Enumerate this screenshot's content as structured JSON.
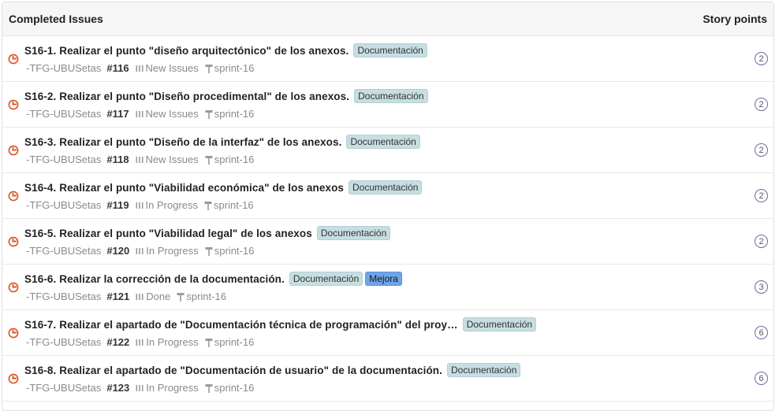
{
  "header": {
    "title": "Completed Issues",
    "story_points_label": "Story points"
  },
  "colors": {
    "issue_icon": "#d9531e",
    "label_doc": "#c6dee2",
    "label_mejora": "#6fa4e8",
    "points_border": "#6a6aa8"
  },
  "issues": [
    {
      "title": "S16-1. Realizar el punto \"diseño arquitectónico\" de los anexos.",
      "labels": [
        "Documentación"
      ],
      "repo": "-TFG-UBUSetas",
      "number": "#116",
      "status": "New Issues",
      "sprint": "sprint-16",
      "points": "2"
    },
    {
      "title": "S16-2. Realizar el punto \"Diseño procedimental\" de los anexos.",
      "labels": [
        "Documentación"
      ],
      "repo": "-TFG-UBUSetas",
      "number": "#117",
      "status": "New Issues",
      "sprint": "sprint-16",
      "points": "2"
    },
    {
      "title": "S16-3. Realizar el punto \"Diseño de la interfaz\" de los anexos.",
      "labels": [
        "Documentación"
      ],
      "repo": "-TFG-UBUSetas",
      "number": "#118",
      "status": "New Issues",
      "sprint": "sprint-16",
      "points": "2"
    },
    {
      "title": "S16-4. Realizar el punto \"Viabilidad económica\" de los anexos",
      "labels": [
        "Documentación"
      ],
      "repo": "-TFG-UBUSetas",
      "number": "#119",
      "status": "In Progress",
      "sprint": "sprint-16",
      "points": "2"
    },
    {
      "title": "S16-5. Realizar el punto \"Viabilidad legal\" de los anexos",
      "labels": [
        "Documentación"
      ],
      "repo": "-TFG-UBUSetas",
      "number": "#120",
      "status": "In Progress",
      "sprint": "sprint-16",
      "points": "2"
    },
    {
      "title": "S16-6. Realizar la corrección de la documentación.",
      "labels": [
        "Documentación",
        "Mejora"
      ],
      "repo": "-TFG-UBUSetas",
      "number": "#121",
      "status": "Done",
      "sprint": "sprint-16",
      "points": "3"
    },
    {
      "title": "S16-7. Realizar el apartado de \"Documentación técnica de programación\" del proy…",
      "labels": [
        "Documentación"
      ],
      "repo": "-TFG-UBUSetas",
      "number": "#122",
      "status": "In Progress",
      "sprint": "sprint-16",
      "points": "6"
    },
    {
      "title": "S16-8. Realizar el apartado de \"Documentación de usuario\" de la documentación.",
      "labels": [
        "Documentación"
      ],
      "repo": "-TFG-UBUSetas",
      "number": "#123",
      "status": "In Progress",
      "sprint": "sprint-16",
      "points": "6"
    }
  ]
}
